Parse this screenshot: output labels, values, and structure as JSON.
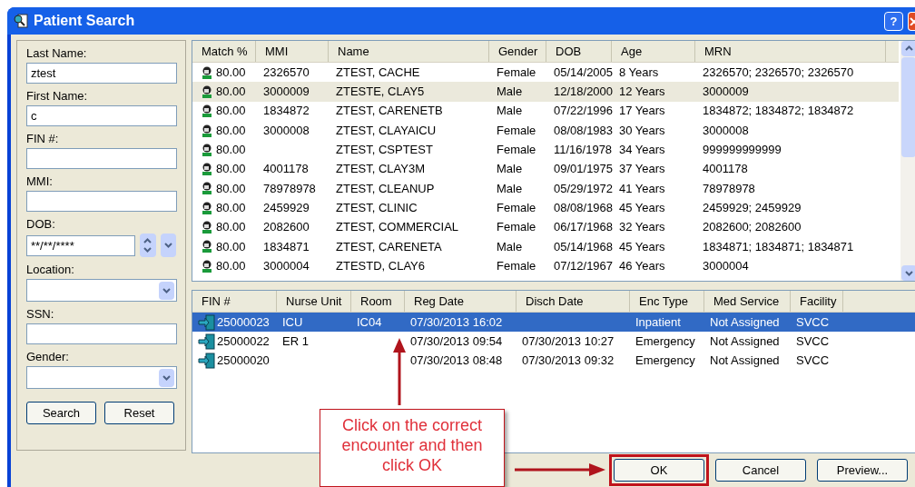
{
  "window": {
    "title": "Patient Search",
    "help_button": "?"
  },
  "search_fields": [
    {
      "label": "Last Name:",
      "kind": "text",
      "value": "ztest"
    },
    {
      "label": "First Name:",
      "kind": "text",
      "value": "c"
    },
    {
      "label": "FIN #:",
      "kind": "text"
    },
    {
      "label": "MMI:",
      "kind": "text"
    },
    {
      "label": "DOB:",
      "kind": "date",
      "value": "**/**/****"
    },
    {
      "label": "Location:",
      "kind": "select"
    },
    {
      "label": "SSN:",
      "kind": "text"
    },
    {
      "label": "Gender:",
      "kind": "select"
    }
  ],
  "search_buttons": [
    "Search",
    "Reset"
  ],
  "patients": {
    "columns": [
      "Match %",
      "MMI",
      "Name",
      "Gender",
      "DOB",
      "Age",
      "MRN"
    ],
    "rows": [
      {
        "selected": false,
        "cells": [
          "80.00",
          "2326570",
          "ZTEST, CACHE",
          "Female",
          "05/14/2005",
          "8 Years",
          "2326570; 2326570; 2326570"
        ]
      },
      {
        "selected": true,
        "cells": [
          "80.00",
          "3000009",
          "ZTESTE, CLAY5",
          "Male",
          "12/18/2000",
          "12 Years",
          "3000009"
        ]
      },
      {
        "selected": false,
        "cells": [
          "80.00",
          "1834872",
          "ZTEST, CARENETB",
          "Male",
          "07/22/1996",
          "17 Years",
          "1834872; 1834872; 1834872"
        ]
      },
      {
        "selected": false,
        "cells": [
          "80.00",
          "3000008",
          "ZTEST, CLAYAICU",
          "Female",
          "08/08/1983",
          "30 Years",
          "3000008"
        ]
      },
      {
        "selected": false,
        "cells": [
          "80.00",
          "",
          "ZTEST, CSPTEST",
          "Female",
          "11/16/1978",
          "34 Years",
          "999999999999"
        ]
      },
      {
        "selected": false,
        "cells": [
          "80.00",
          "4001178",
          "ZTEST, CLAY3M",
          "Male",
          "09/01/1975",
          "37 Years",
          "4001178"
        ]
      },
      {
        "selected": false,
        "cells": [
          "80.00",
          "78978978",
          "ZTEST, CLEANUP",
          "Male",
          "05/29/1972",
          "41 Years",
          "78978978"
        ]
      },
      {
        "selected": false,
        "cells": [
          "80.00",
          "2459929",
          "ZTEST, CLINIC",
          "Female",
          "08/08/1968",
          "45 Years",
          "2459929; 2459929"
        ]
      },
      {
        "selected": false,
        "cells": [
          "80.00",
          "2082600",
          "ZTEST, COMMERCIAL",
          "Female",
          "06/17/1968",
          "32 Years",
          "2082600; 2082600"
        ]
      },
      {
        "selected": false,
        "cells": [
          "80.00",
          "1834871",
          "ZTEST, CARENETA",
          "Male",
          "05/14/1968",
          "45 Years",
          "1834871; 1834871; 1834871"
        ]
      },
      {
        "selected": false,
        "cells": [
          "80.00",
          "3000004",
          "ZTESTD, CLAY6",
          "Female",
          "07/12/1967",
          "46 Years",
          "3000004"
        ]
      }
    ]
  },
  "encounters": {
    "columns": [
      "FIN #",
      "Nurse Unit",
      "Room",
      "Reg Date",
      "Disch Date",
      "Enc Type",
      "Med Service",
      "Facility"
    ],
    "rows": [
      {
        "selected": true,
        "cells": [
          "25000023",
          "ICU",
          "IC04",
          "07/30/2013 16:02",
          "",
          "Inpatient",
          "Not Assigned",
          "SVCC"
        ]
      },
      {
        "selected": false,
        "cells": [
          "25000022",
          "ER 1",
          "",
          "07/30/2013 09:54",
          "07/30/2013 10:27",
          "Emergency",
          "Not Assigned",
          "SVCC"
        ]
      },
      {
        "selected": false,
        "cells": [
          "25000020",
          "",
          "",
          "07/30/2013 08:48",
          "07/30/2013 09:32",
          "Emergency",
          "Not Assigned",
          "SVCC"
        ]
      }
    ]
  },
  "dialog_buttons": [
    {
      "label": "OK",
      "highlighted": true
    },
    {
      "label": "Cancel",
      "highlighted": false
    },
    {
      "label": "Preview...",
      "highlighted": false
    }
  ],
  "annotation": "Click on the correct encounter and then click OK"
}
